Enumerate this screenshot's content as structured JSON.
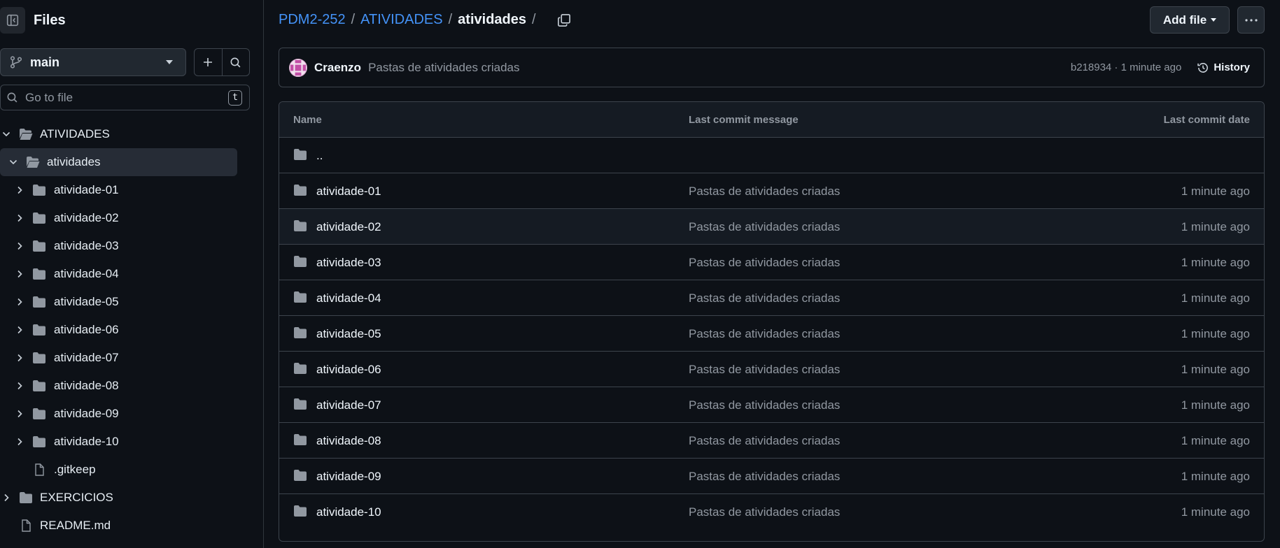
{
  "sidebar": {
    "title": "Files",
    "toggle_icon": "sidebar-collapse-icon",
    "branch": "main",
    "search_placeholder": "Go to file",
    "search_shortcut": "t",
    "tree": [
      {
        "label": "ATIVIDADES",
        "type": "folder",
        "expanded": true,
        "depth": 0
      },
      {
        "label": "atividades",
        "type": "folder",
        "expanded": true,
        "depth": 1,
        "active": true
      },
      {
        "label": "atividade-01",
        "type": "folder",
        "expanded": false,
        "depth": 2
      },
      {
        "label": "atividade-02",
        "type": "folder",
        "expanded": false,
        "depth": 2
      },
      {
        "label": "atividade-03",
        "type": "folder",
        "expanded": false,
        "depth": 2
      },
      {
        "label": "atividade-04",
        "type": "folder",
        "expanded": false,
        "depth": 2
      },
      {
        "label": "atividade-05",
        "type": "folder",
        "expanded": false,
        "depth": 2
      },
      {
        "label": "atividade-06",
        "type": "folder",
        "expanded": false,
        "depth": 2
      },
      {
        "label": "atividade-07",
        "type": "folder",
        "expanded": false,
        "depth": 2
      },
      {
        "label": "atividade-08",
        "type": "folder",
        "expanded": false,
        "depth": 2
      },
      {
        "label": "atividade-09",
        "type": "folder",
        "expanded": false,
        "depth": 2
      },
      {
        "label": "atividade-10",
        "type": "folder",
        "expanded": false,
        "depth": 2
      },
      {
        "label": ".gitkeep",
        "type": "file",
        "depth": 2
      },
      {
        "label": "EXERCICIOS",
        "type": "folder",
        "expanded": false,
        "depth": 0
      },
      {
        "label": "README.md",
        "type": "file",
        "depth": 0
      }
    ]
  },
  "breadcrumb": {
    "repo": "PDM2-252",
    "dir": "ATIVIDADES",
    "current": "atividades",
    "sep": "/"
  },
  "header": {
    "add_file": "Add file"
  },
  "commit": {
    "author": "Craenzo",
    "message": "Pastas de atividades criadas",
    "sha_time": "b218934 · 1 minute ago",
    "history": "History"
  },
  "table": {
    "columns": [
      "Name",
      "Last commit message",
      "Last commit date"
    ],
    "parent": "..",
    "rows": [
      {
        "name": "atividade-01",
        "message": "Pastas de atividades criadas",
        "date": "1 minute ago"
      },
      {
        "name": "atividade-02",
        "message": "Pastas de atividades criadas",
        "date": "1 minute ago"
      },
      {
        "name": "atividade-03",
        "message": "Pastas de atividades criadas",
        "date": "1 minute ago"
      },
      {
        "name": "atividade-04",
        "message": "Pastas de atividades criadas",
        "date": "1 minute ago"
      },
      {
        "name": "atividade-05",
        "message": "Pastas de atividades criadas",
        "date": "1 minute ago"
      },
      {
        "name": "atividade-06",
        "message": "Pastas de atividades criadas",
        "date": "1 minute ago"
      },
      {
        "name": "atividade-07",
        "message": "Pastas de atividades criadas",
        "date": "1 minute ago"
      },
      {
        "name": "atividade-08",
        "message": "Pastas de atividades criadas",
        "date": "1 minute ago"
      },
      {
        "name": "atividade-09",
        "message": "Pastas de atividades criadas",
        "date": "1 minute ago"
      },
      {
        "name": "atividade-10",
        "message": "Pastas de atividades criadas",
        "date": "1 minute ago"
      }
    ]
  },
  "colors": {
    "bg": "#0d1117",
    "border": "#3d444d",
    "link": "#4493f8",
    "muted": "#9198a1",
    "active_row": "#262c36"
  }
}
